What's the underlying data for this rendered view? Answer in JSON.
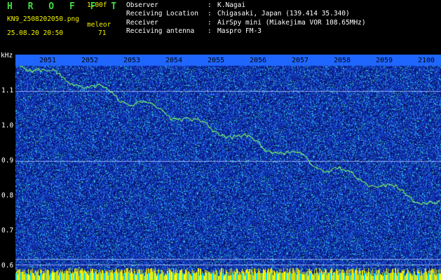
{
  "header": {
    "app_name": "H R O F F T",
    "version": "1.00f",
    "file_name": "KN9_2508202050.png",
    "mode_label": "meleor",
    "timestamp": "25.08.20 20:50",
    "value": "71"
  },
  "info": [
    {
      "label": "Observer",
      "sep": ":",
      "value": "K.Nagai"
    },
    {
      "label": "Receiving Location",
      "sep": ":",
      "value": "Chigasaki, Japan (139.414 35.340)"
    },
    {
      "label": "Receiver",
      "sep": ":",
      "value": "AirSpy mini (Miakejima VOR 108.65MHz)"
    },
    {
      "label": "Receiving antenna",
      "sep": ":",
      "value": "Maspro FM-3"
    }
  ],
  "axis": {
    "y_unit": "kHz",
    "y_ticks": [
      "1.1",
      "1.0",
      "0.9",
      "0.8",
      "0.7",
      "0.6"
    ],
    "x_ticks": [
      "2051",
      "2052",
      "2053",
      "2054",
      "2055",
      "2056",
      "2057",
      "2058",
      "2059",
      "2100"
    ]
  },
  "colors": {
    "background": "#000000",
    "waterfall_dark": "#0a1a8c",
    "waterfall_mid": "#1e50ff",
    "waterfall_bright": "#30e6c8",
    "signal": "#7cf26a",
    "noise_floor": "#ffff00",
    "brand": "#3fdc3f",
    "accent_text": "#f2f200"
  }
}
